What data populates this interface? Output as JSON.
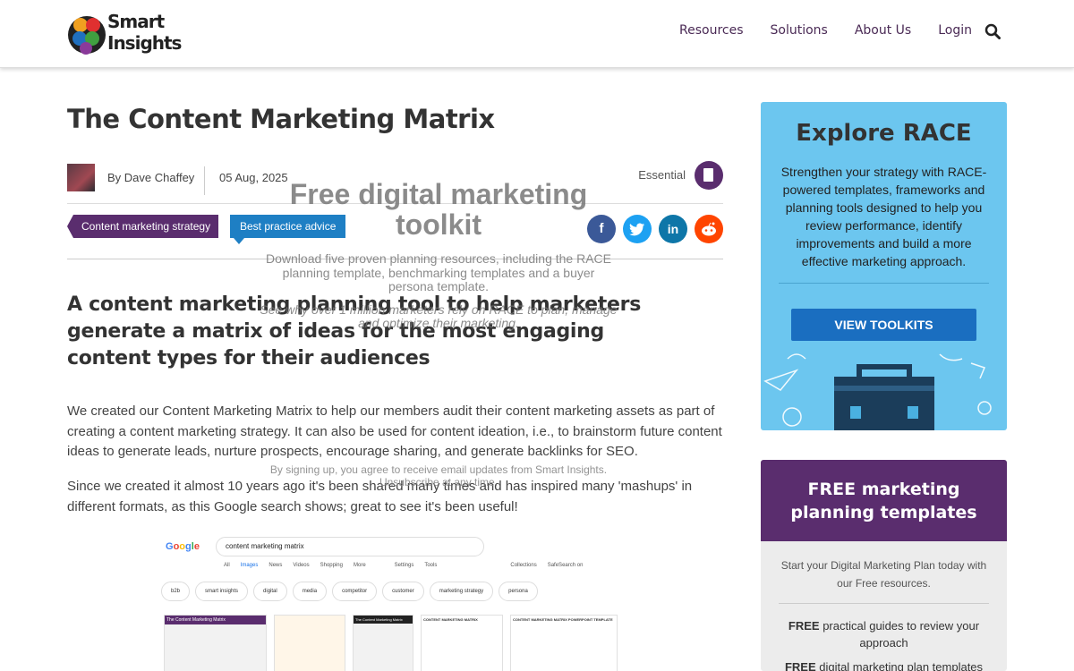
{
  "header": {
    "logo_line1": "Smart",
    "logo_line2": "Insights",
    "nav": [
      "Resources",
      "Solutions",
      "About Us",
      "Login"
    ]
  },
  "article": {
    "title": "The Content Marketing Matrix",
    "author": "By Dave Chaffey",
    "date": "05 Aug, 2025",
    "level": "Essential",
    "tags": [
      "Content marketing strategy",
      "Best practice advice"
    ],
    "share": [
      "facebook",
      "twitter",
      "linkedin",
      "reddit"
    ],
    "subtitle": "A content marketing planning tool to help marketers generate a matrix of ideas for the most engaging content types for their audiences",
    "para1": "We created our Content Marketing Matrix to help our members audit their content marketing assets as part of creating a content marketing strategy. It can also be used for content ideation, i.e., to brainstorm future content ideas to generate leads, nurture prospects, encourage sharing, and generate backlinks for SEO.",
    "para2": "Since we created it almost 10 years ago it's been shared many times and has inspired many 'mashups' in different formats, as this Google search shows; great to see it's been useful!"
  },
  "overlay": {
    "title": "Free digital marketing toolkit",
    "body": "Download five proven planning resources, including the RACE planning template, benchmarking templates and a buyer persona template.",
    "body2": "See why over 1 million marketers rely on RACE to plan, manage and optimize their marketing.",
    "legal": "By signing up, you agree to receive email updates from Smart Insights.",
    "unsubscribe": "Unsubscribe at any time."
  },
  "screenshot": {
    "query": "content marketing matrix",
    "tabs": [
      "All",
      "Images",
      "News",
      "Videos",
      "Shopping",
      "More",
      "Settings",
      "Tools",
      "Collections",
      "SafeSearch on"
    ],
    "chips": [
      "b2b",
      "smart insights",
      "digital",
      "media",
      "competitor",
      "customer",
      "marketing strategy",
      "persona"
    ],
    "thumb_labels": [
      "The Content Marketing Matrix",
      "",
      "The Content Marketing Matrix",
      "CONTENT MARKETING MATRIX",
      "CONTENT MARKETING MATRIX POWERPOINT TEMPLATE"
    ]
  },
  "sidebar_race": {
    "title": "Explore RACE",
    "text": "Strengthen your strategy with RACE-powered templates, frameworks and planning tools designed to help you review performance, identify improvements and build a more effective marketing approach.",
    "button": "VIEW TOOLKITS"
  },
  "sidebar_free": {
    "title": "FREE marketing planning templates",
    "text": "Start your Digital Marketing Plan today with our Free resources.",
    "item1_bold": "FREE",
    "item1_rest": " practical guides to review your approach",
    "item2_bold": "FREE",
    "item2_rest": " digital marketing plan templates"
  },
  "colors": {
    "purple": "#5a2d6e",
    "blue": "#1e7fc4",
    "sky": "#6cc6ef",
    "facebook": "#3b5998",
    "twitter": "#1da1f2",
    "linkedin": "#0e76a8",
    "reddit": "#ff4500"
  }
}
